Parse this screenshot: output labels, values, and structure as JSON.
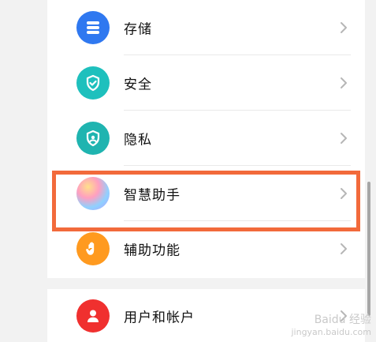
{
  "settings": {
    "items": [
      {
        "label": "存储",
        "icon": "storage-icon",
        "color": "#2f78f0"
      },
      {
        "label": "安全",
        "icon": "shield-check-icon",
        "color": "#1ec0bd"
      },
      {
        "label": "隐私",
        "icon": "privacy-shield-icon",
        "color": "#1fb4b0"
      },
      {
        "label": "智慧助手",
        "icon": "smart-assistant-orb-icon",
        "color": "#b9a8ff"
      },
      {
        "label": "辅助功能",
        "icon": "hand-icon",
        "color": "#ff9a1f"
      },
      {
        "label": "用户和帐户",
        "icon": "user-icon",
        "color": "#f0302f"
      }
    ]
  },
  "watermark": {
    "line1": "Baidu 经验",
    "line2": "jingyan.baidu.com"
  }
}
